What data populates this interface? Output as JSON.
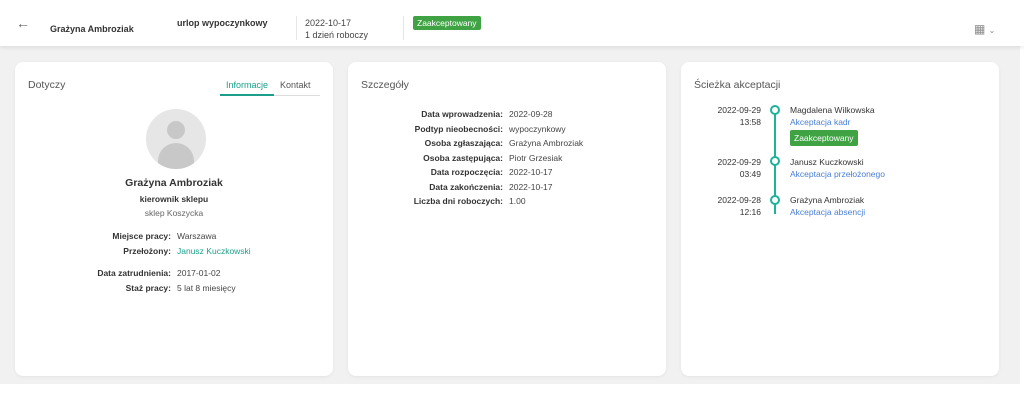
{
  "header": {
    "name": "Grażyna Ambroziak",
    "type": "urlop wypoczynkowy",
    "date": "2022-10-17",
    "days": "1 dzień roboczy",
    "status": "Zaakceptowany"
  },
  "colors": {
    "accent": "#1b9f8a",
    "badge": "#3fa344",
    "link": "#4a7fd4"
  },
  "about": {
    "title": "Dotyczy",
    "tabs": [
      "Informacje",
      "Kontakt"
    ],
    "name": "Grażyna Ambroziak",
    "position": "kierownik sklepu",
    "location": "sklep Koszycka",
    "fields": [
      {
        "k": "Miejsce pracy:",
        "v": "Warszawa"
      },
      {
        "k": "Przełożony:",
        "v": "Janusz Kuczkowski"
      }
    ],
    "fields2": [
      {
        "k": "Data zatrudnienia:",
        "v": "2017-01-02"
      },
      {
        "k": "Staż pracy:",
        "v": "5 lat 8 miesięcy"
      }
    ]
  },
  "details": {
    "title": "Szczegóły",
    "fields": [
      {
        "k": "Data wprowadzenia:",
        "v": "2022-09-28"
      },
      {
        "k": "Podtyp nieobecności:",
        "v": "wypoczynkowy"
      },
      {
        "k": "Osoba zgłaszająca:",
        "v": "Grażyna Ambroziak"
      },
      {
        "k": "Osoba zastępująca:",
        "v": "Piotr Grzesiak"
      },
      {
        "k": "Data rozpoczęcia:",
        "v": "2022-10-17"
      },
      {
        "k": "Data zakończenia:",
        "v": "2022-10-17"
      },
      {
        "k": "Liczba dni roboczych:",
        "v": "1.00"
      }
    ]
  },
  "path": {
    "title": "Ścieżka akceptacji",
    "steps": [
      {
        "date": "2022-09-29",
        "time": "13:58",
        "name": "Magdalena Wilkowska",
        "role": "Akceptacja kadr",
        "status": "Zaakceptowany"
      },
      {
        "date": "2022-09-29",
        "time": "03:49",
        "name": "Janusz Kuczkowski",
        "role": "Akceptacja przełożonego"
      },
      {
        "date": "2022-09-28",
        "time": "12:16",
        "name": "Grażyna Ambroziak",
        "role": "Akceptacja absencji"
      }
    ]
  }
}
